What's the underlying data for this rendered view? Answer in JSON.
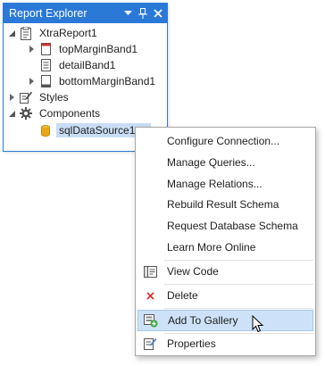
{
  "panel": {
    "title": "Report Explorer",
    "icons": [
      "dropdown-icon",
      "pin-icon",
      "close-icon"
    ],
    "tree": {
      "root": "XtraReport1",
      "bands": [
        "topMarginBand1",
        "detailBand1",
        "bottomMarginBand1"
      ],
      "styles": "Styles",
      "components": "Components",
      "datasource": "sqlDataSource1"
    }
  },
  "context_menu": {
    "items": [
      "Configure Connection...",
      "Manage Queries...",
      "Manage Relations...",
      "Rebuild Result Schema",
      "Request Database Schema",
      "Learn More Online"
    ],
    "view_code": "View Code",
    "delete": "Delete",
    "add_to_gallery": "Add To Gallery",
    "properties": "Properties"
  },
  "colors": {
    "title_bar": "#2b79d7",
    "selection": "#c9def5",
    "menu_hover": "#cde2f8",
    "delete_icon": "#d13438",
    "datasource_icon": "#e6a817"
  }
}
